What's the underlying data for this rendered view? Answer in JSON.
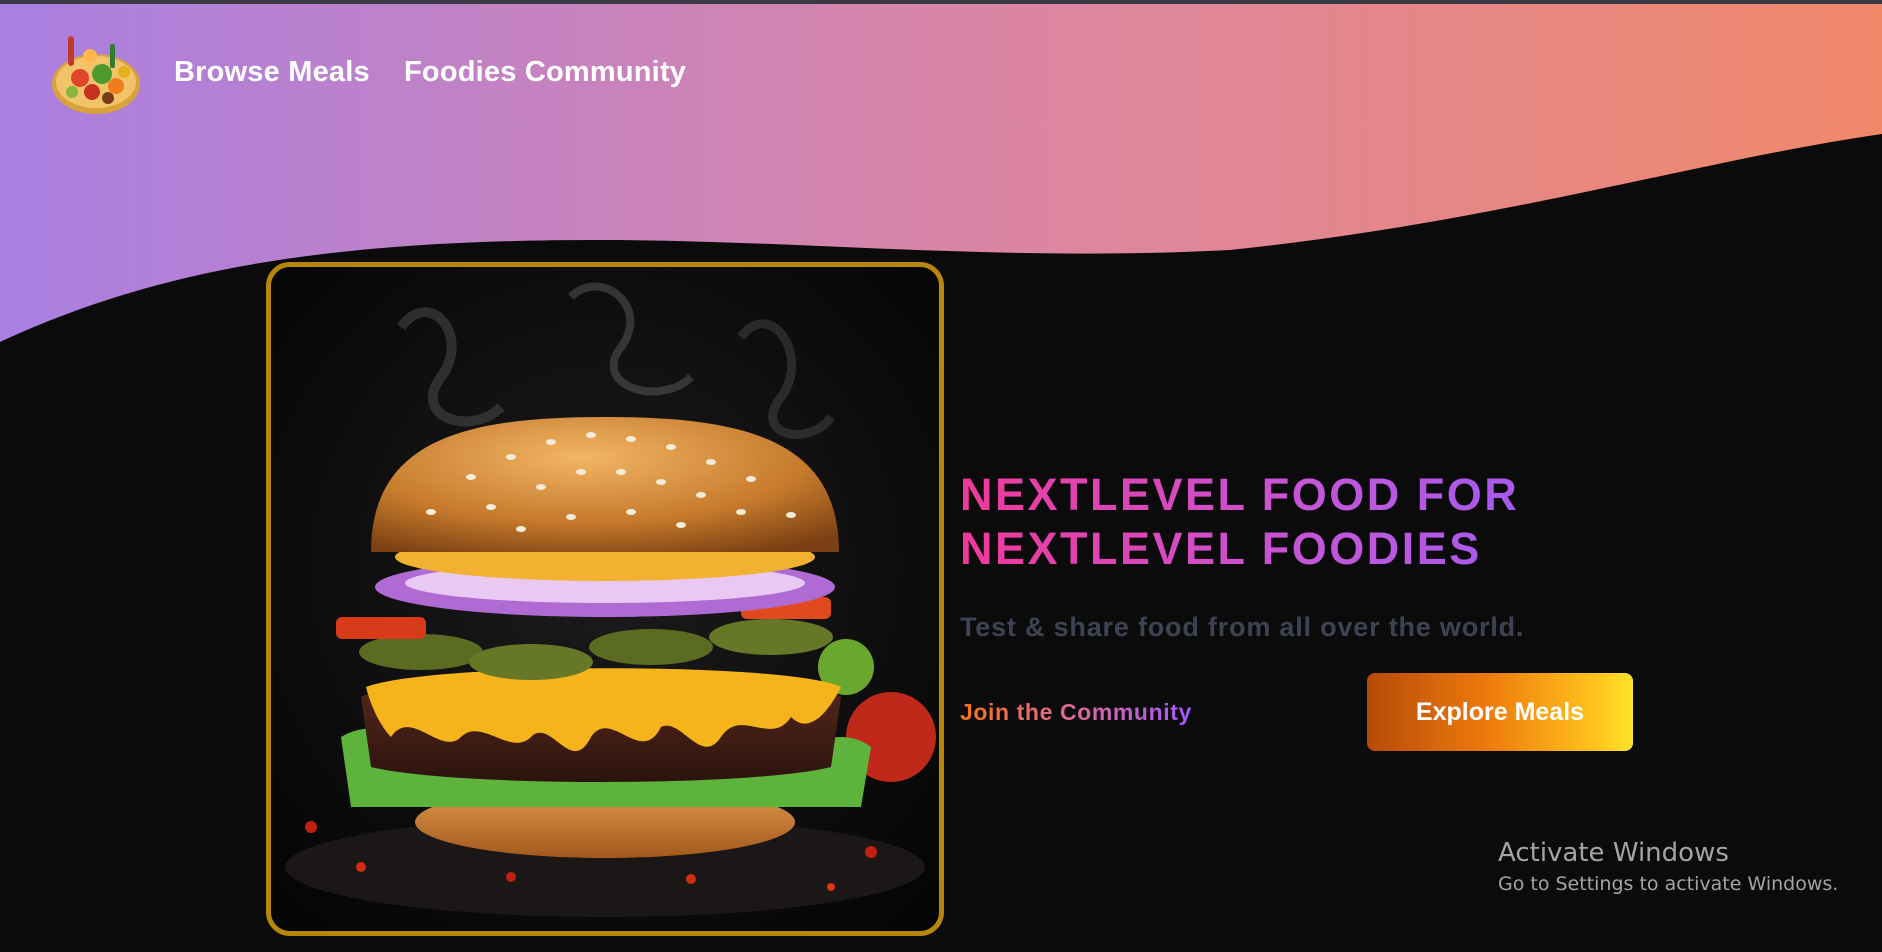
{
  "nav": {
    "logo_alt": "",
    "links": [
      {
        "label": "Browse Meals"
      },
      {
        "label": "Foodies Community"
      }
    ]
  },
  "hero": {
    "headline_lines": [
      "NEXTLEVEL FOOD FOR",
      "NEXTLEVEL FOODIES"
    ],
    "tagline": "Test & share food from all over the world.",
    "join_label": "Join the Community",
    "explore_label": "Explore Meals"
  },
  "overlay": {
    "title": "Activate Windows",
    "subtitle": "Go to Settings to activate Windows."
  },
  "colors": {
    "header_gradient_start": "#a97fe2",
    "header_gradient_end": "#f0886a",
    "background": "#0b0b0c",
    "frame_border": "#b8860b",
    "headline_start": "#f0399a",
    "headline_end": "#9a5cf5",
    "button_start": "#b64a06",
    "button_end": "#ffe32a"
  },
  "icons": {
    "logo": "food-plate-logo-icon"
  }
}
